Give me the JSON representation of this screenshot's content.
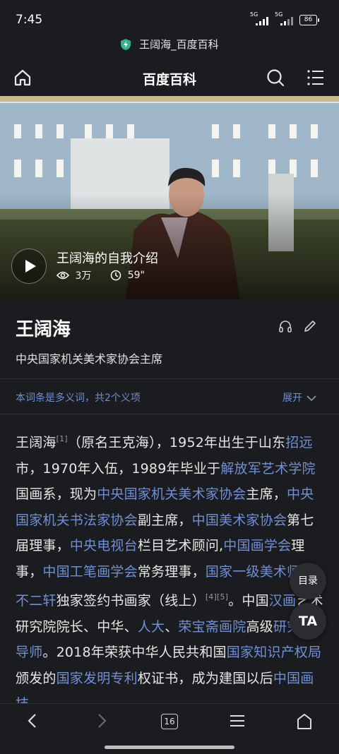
{
  "status": {
    "time": "7:45",
    "signal1": "5G",
    "signal2": "5G",
    "battery": "86"
  },
  "url_bar": {
    "title": "王阔海_百度百科"
  },
  "nav": {
    "title": "百度百科",
    "icons": [
      "home-icon",
      "search-icon",
      "menu-icon"
    ]
  },
  "video": {
    "title": "王阔海的自我介绍",
    "views": "3万",
    "duration": "59\""
  },
  "entry": {
    "title": "王阔海",
    "subtitle": "中央国家机关美术家协会主席",
    "icons": [
      "headphones-icon",
      "pencil-icon"
    ]
  },
  "polysemy": {
    "text": "本词条是多义词，共2个义项",
    "expand": "展开"
  },
  "article": {
    "t1": "王阔海",
    "ref1": "[1]",
    "t2": "（原名王克海），1952年出生于山东",
    "l1": "招远",
    "t3": "市，1970年入伍，1989年毕业于",
    "l2": "解放军艺术学院",
    "t4": "国画系，现为",
    "l3": "中央国家机关美术家协会",
    "t5": "主席，",
    "l4": "中央国家机关书法家协会",
    "t6": "副主席，",
    "l5": "中国美术家协会",
    "t7": "第七届理事，",
    "l6": "中央电视台",
    "t8": "栏目艺术顾问,",
    "l7": "中国画学会",
    "t9": "理事，",
    "l8": "中国工笔画学会",
    "t10": "常务理事，",
    "l9": "国家一级美术师",
    "t11": "，",
    "l10": "不二轩",
    "t12": "独家签约书画家（线上）",
    "ref2": "[4][5]",
    "t13": "。中国",
    "l11": "汉画",
    "t14": "艺术研究院院长、中华、",
    "l12": "人大",
    "t15": "、",
    "l13": "荣宝斋画院",
    "t16": "高级",
    "l14": "研究生导师",
    "t17": "。2018年荣获中华人民共和国",
    "l15": "国家知识产权局",
    "t18": "颁发的",
    "l16": "国家发明专利",
    "t19": "权证书，成为建国以后",
    "l17": "中国画技"
  },
  "floating": {
    "toc": "目录",
    "ta": "TA"
  },
  "bottom_bar": {
    "tab_count": "16",
    "icons": [
      "back-icon",
      "forward-icon",
      "tabs-icon",
      "menu-icon",
      "home-icon"
    ]
  },
  "colors": {
    "background": "#1b1c1f",
    "link": "#6f8fd6",
    "text": "#e6e6e6"
  }
}
